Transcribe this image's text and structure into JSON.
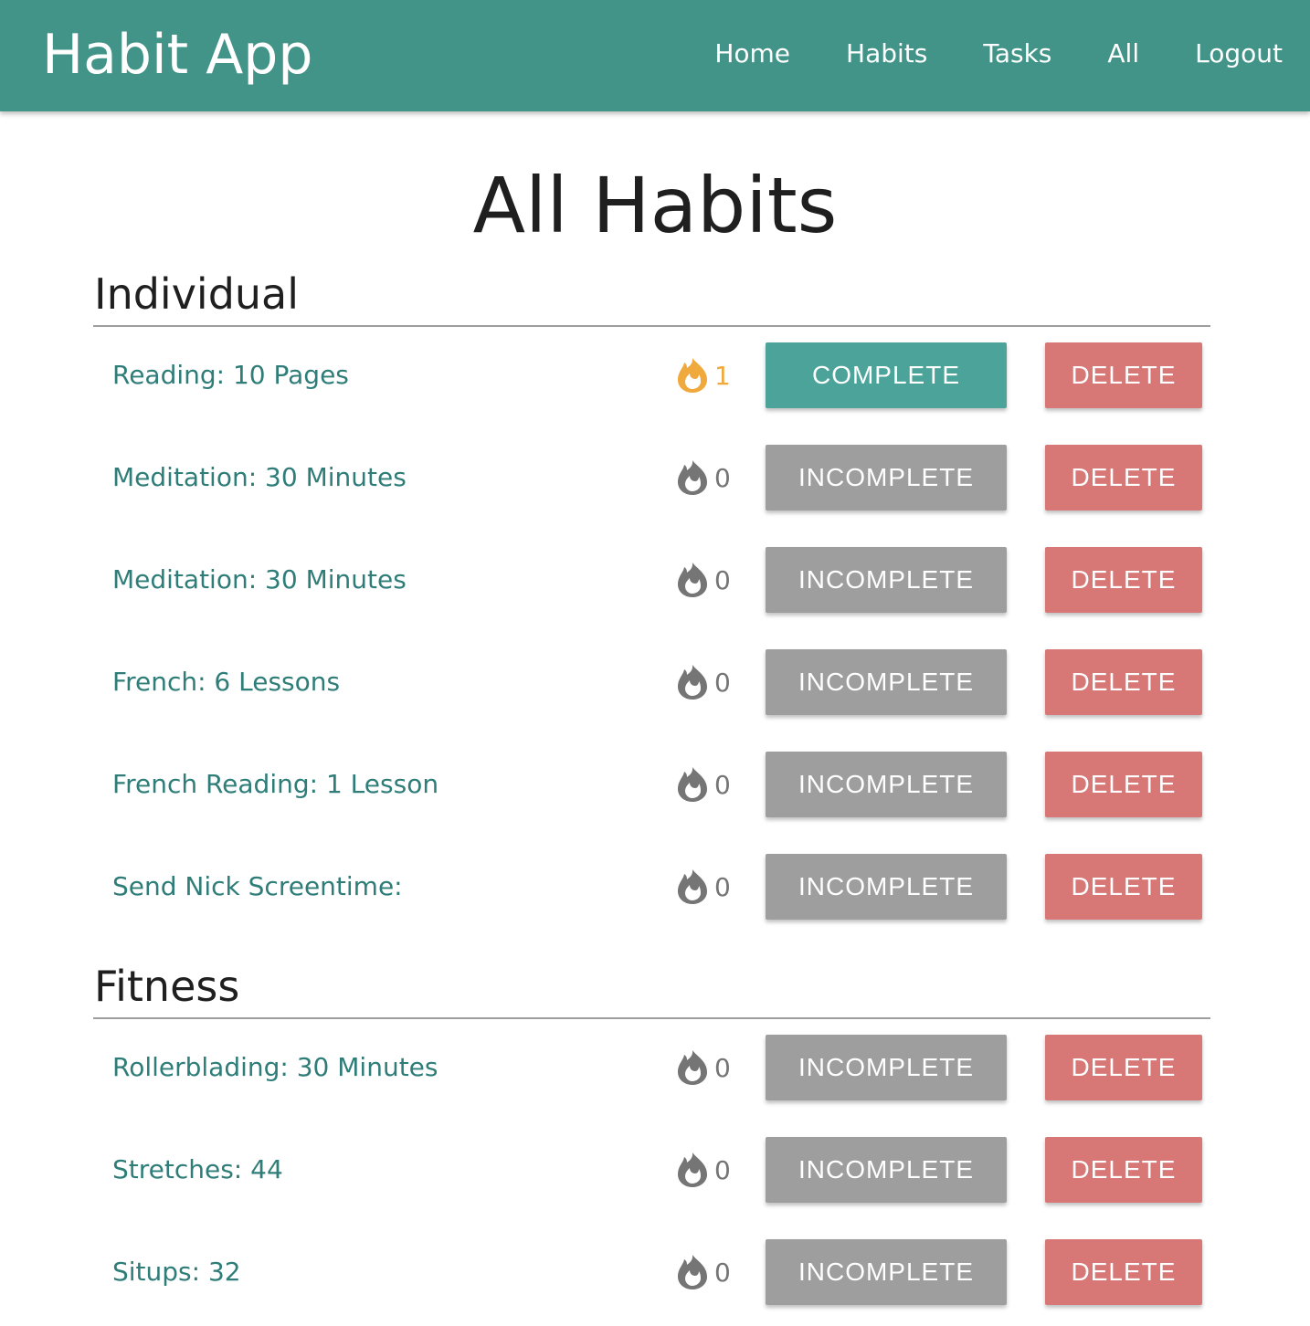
{
  "app": {
    "title": "Habit App"
  },
  "nav": {
    "items": [
      {
        "label": "Home"
      },
      {
        "label": "Habits"
      },
      {
        "label": "Tasks"
      },
      {
        "label": "All"
      },
      {
        "label": "Logout"
      }
    ]
  },
  "page": {
    "title": "All Habits"
  },
  "colors": {
    "navbar": "#429488",
    "habit_text": "#2f7d78",
    "complete_button": "#4ba39a",
    "incomplete_button": "#9e9e9e",
    "delete_button": "#d87876",
    "streak_active": "#f0a93c",
    "streak_inactive": "#757575"
  },
  "sections": [
    {
      "title": "Individual",
      "habits": [
        {
          "name": "Reading: 10 Pages",
          "streak": "1",
          "status_label": "COMPLETE",
          "delete_label": "DELETE",
          "complete": true,
          "streak_icon": "flame-icon"
        },
        {
          "name": "Meditation: 30 Minutes",
          "streak": "0",
          "status_label": "INCOMPLETE",
          "delete_label": "DELETE",
          "complete": false,
          "streak_icon": "flame-icon"
        },
        {
          "name": "Meditation: 30 Minutes",
          "streak": "0",
          "status_label": "INCOMPLETE",
          "delete_label": "DELETE",
          "complete": false,
          "streak_icon": "flame-icon"
        },
        {
          "name": "French: 6 Lessons",
          "streak": "0",
          "status_label": "INCOMPLETE",
          "delete_label": "DELETE",
          "complete": false,
          "streak_icon": "flame-icon"
        },
        {
          "name": "French Reading: 1 Lesson",
          "streak": "0",
          "status_label": "INCOMPLETE",
          "delete_label": "DELETE",
          "complete": false,
          "streak_icon": "flame-icon"
        },
        {
          "name": "Send Nick Screentime:",
          "streak": "0",
          "status_label": "INCOMPLETE",
          "delete_label": "DELETE",
          "complete": false,
          "streak_icon": "flame-icon"
        }
      ]
    },
    {
      "title": "Fitness",
      "habits": [
        {
          "name": "Rollerblading: 30 Minutes",
          "streak": "0",
          "status_label": "INCOMPLETE",
          "delete_label": "DELETE",
          "complete": false,
          "streak_icon": "flame-icon"
        },
        {
          "name": "Stretches: 44",
          "streak": "0",
          "status_label": "INCOMPLETE",
          "delete_label": "DELETE",
          "complete": false,
          "streak_icon": "flame-icon"
        },
        {
          "name": "Situps: 32",
          "streak": "0",
          "status_label": "INCOMPLETE",
          "delete_label": "DELETE",
          "complete": false,
          "streak_icon": "flame-icon"
        }
      ]
    }
  ]
}
